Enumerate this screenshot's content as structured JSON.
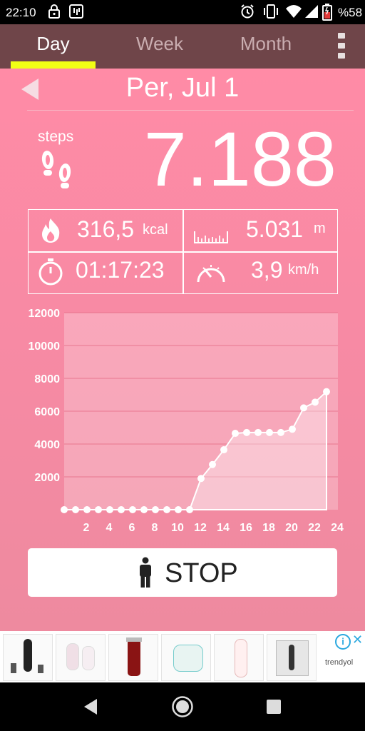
{
  "status_bar": {
    "time": "22:10",
    "battery": "%58",
    "icons": [
      "lock-icon",
      "app-notification-icon",
      "alarm-icon",
      "vibrate-icon",
      "wifi-icon",
      "signal-icon",
      "battery-icon"
    ]
  },
  "tabs": [
    {
      "label": "Day",
      "active": true
    },
    {
      "label": "Week",
      "active": false
    },
    {
      "label": "Month",
      "active": false
    }
  ],
  "colors": {
    "accent": "#f1ff15",
    "tab_bar": "#6f4549",
    "background": "#ff8ba6"
  },
  "date": "Per, Jul 1",
  "steps": {
    "label": "steps",
    "value": "7.188"
  },
  "stats": {
    "calories": {
      "value": "316,5",
      "unit": "kcal"
    },
    "distance": {
      "value": "5.031",
      "unit": "m"
    },
    "duration": {
      "value": "01:17:23"
    },
    "speed": {
      "value": "3,9",
      "unit": "km/h"
    }
  },
  "chart_data": {
    "type": "area",
    "x": [
      0,
      1,
      2,
      3,
      4,
      5,
      6,
      7,
      8,
      9,
      10,
      11,
      12,
      13,
      14,
      15,
      16,
      17,
      18,
      19,
      20,
      21,
      22,
      23
    ],
    "values": [
      0,
      0,
      0,
      0,
      0,
      0,
      0,
      0,
      0,
      0,
      0,
      0,
      1900,
      2750,
      3650,
      4650,
      4700,
      4700,
      4700,
      4700,
      4900,
      6200,
      6550,
      7188
    ],
    "xticks": [
      "2",
      "4",
      "6",
      "8",
      "10",
      "12",
      "14",
      "16",
      "18",
      "20",
      "22",
      "24"
    ],
    "yticks": [
      "2000",
      "4000",
      "6000",
      "8000",
      "10000",
      "12000"
    ],
    "xlim": [
      0,
      24
    ],
    "ylim": [
      0,
      12000
    ],
    "grid": true
  },
  "stop_button": {
    "label": "STOP"
  },
  "ad": {
    "brand": "trendyol",
    "items": [
      "body-groomer-product",
      "epilator-set-product",
      "hair-clipper-product",
      "epilator-product",
      "lady-shaver-product",
      "hair-styler-product"
    ]
  }
}
